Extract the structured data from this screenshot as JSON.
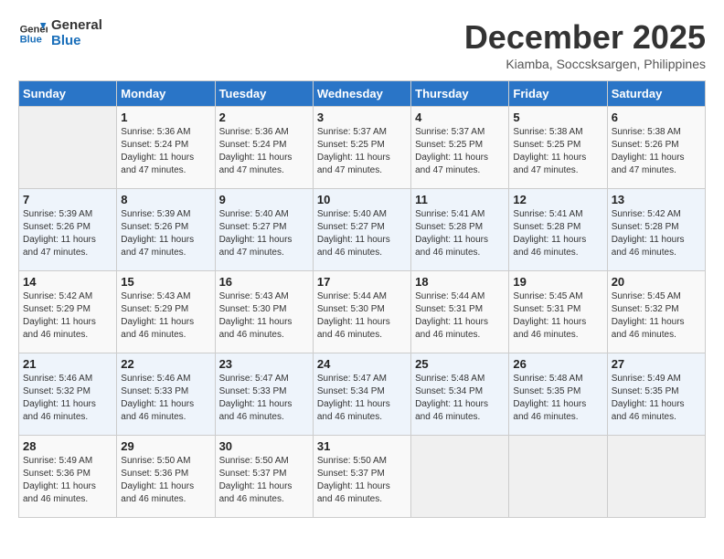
{
  "logo": {
    "line1": "General",
    "line2": "Blue"
  },
  "title": "December 2025",
  "subtitle": "Kiamba, Soccsksargen, Philippines",
  "headers": [
    "Sunday",
    "Monday",
    "Tuesday",
    "Wednesday",
    "Thursday",
    "Friday",
    "Saturday"
  ],
  "weeks": [
    [
      {
        "day": "",
        "sunrise": "",
        "sunset": "",
        "daylight": ""
      },
      {
        "day": "1",
        "sunrise": "Sunrise: 5:36 AM",
        "sunset": "Sunset: 5:24 PM",
        "daylight": "Daylight: 11 hours and 47 minutes."
      },
      {
        "day": "2",
        "sunrise": "Sunrise: 5:36 AM",
        "sunset": "Sunset: 5:24 PM",
        "daylight": "Daylight: 11 hours and 47 minutes."
      },
      {
        "day": "3",
        "sunrise": "Sunrise: 5:37 AM",
        "sunset": "Sunset: 5:25 PM",
        "daylight": "Daylight: 11 hours and 47 minutes."
      },
      {
        "day": "4",
        "sunrise": "Sunrise: 5:37 AM",
        "sunset": "Sunset: 5:25 PM",
        "daylight": "Daylight: 11 hours and 47 minutes."
      },
      {
        "day": "5",
        "sunrise": "Sunrise: 5:38 AM",
        "sunset": "Sunset: 5:25 PM",
        "daylight": "Daylight: 11 hours and 47 minutes."
      },
      {
        "day": "6",
        "sunrise": "Sunrise: 5:38 AM",
        "sunset": "Sunset: 5:26 PM",
        "daylight": "Daylight: 11 hours and 47 minutes."
      }
    ],
    [
      {
        "day": "7",
        "sunrise": "Sunrise: 5:39 AM",
        "sunset": "Sunset: 5:26 PM",
        "daylight": "Daylight: 11 hours and 47 minutes."
      },
      {
        "day": "8",
        "sunrise": "Sunrise: 5:39 AM",
        "sunset": "Sunset: 5:26 PM",
        "daylight": "Daylight: 11 hours and 47 minutes."
      },
      {
        "day": "9",
        "sunrise": "Sunrise: 5:40 AM",
        "sunset": "Sunset: 5:27 PM",
        "daylight": "Daylight: 11 hours and 47 minutes."
      },
      {
        "day": "10",
        "sunrise": "Sunrise: 5:40 AM",
        "sunset": "Sunset: 5:27 PM",
        "daylight": "Daylight: 11 hours and 46 minutes."
      },
      {
        "day": "11",
        "sunrise": "Sunrise: 5:41 AM",
        "sunset": "Sunset: 5:28 PM",
        "daylight": "Daylight: 11 hours and 46 minutes."
      },
      {
        "day": "12",
        "sunrise": "Sunrise: 5:41 AM",
        "sunset": "Sunset: 5:28 PM",
        "daylight": "Daylight: 11 hours and 46 minutes."
      },
      {
        "day": "13",
        "sunrise": "Sunrise: 5:42 AM",
        "sunset": "Sunset: 5:28 PM",
        "daylight": "Daylight: 11 hours and 46 minutes."
      }
    ],
    [
      {
        "day": "14",
        "sunrise": "Sunrise: 5:42 AM",
        "sunset": "Sunset: 5:29 PM",
        "daylight": "Daylight: 11 hours and 46 minutes."
      },
      {
        "day": "15",
        "sunrise": "Sunrise: 5:43 AM",
        "sunset": "Sunset: 5:29 PM",
        "daylight": "Daylight: 11 hours and 46 minutes."
      },
      {
        "day": "16",
        "sunrise": "Sunrise: 5:43 AM",
        "sunset": "Sunset: 5:30 PM",
        "daylight": "Daylight: 11 hours and 46 minutes."
      },
      {
        "day": "17",
        "sunrise": "Sunrise: 5:44 AM",
        "sunset": "Sunset: 5:30 PM",
        "daylight": "Daylight: 11 hours and 46 minutes."
      },
      {
        "day": "18",
        "sunrise": "Sunrise: 5:44 AM",
        "sunset": "Sunset: 5:31 PM",
        "daylight": "Daylight: 11 hours and 46 minutes."
      },
      {
        "day": "19",
        "sunrise": "Sunrise: 5:45 AM",
        "sunset": "Sunset: 5:31 PM",
        "daylight": "Daylight: 11 hours and 46 minutes."
      },
      {
        "day": "20",
        "sunrise": "Sunrise: 5:45 AM",
        "sunset": "Sunset: 5:32 PM",
        "daylight": "Daylight: 11 hours and 46 minutes."
      }
    ],
    [
      {
        "day": "21",
        "sunrise": "Sunrise: 5:46 AM",
        "sunset": "Sunset: 5:32 PM",
        "daylight": "Daylight: 11 hours and 46 minutes."
      },
      {
        "day": "22",
        "sunrise": "Sunrise: 5:46 AM",
        "sunset": "Sunset: 5:33 PM",
        "daylight": "Daylight: 11 hours and 46 minutes."
      },
      {
        "day": "23",
        "sunrise": "Sunrise: 5:47 AM",
        "sunset": "Sunset: 5:33 PM",
        "daylight": "Daylight: 11 hours and 46 minutes."
      },
      {
        "day": "24",
        "sunrise": "Sunrise: 5:47 AM",
        "sunset": "Sunset: 5:34 PM",
        "daylight": "Daylight: 11 hours and 46 minutes."
      },
      {
        "day": "25",
        "sunrise": "Sunrise: 5:48 AM",
        "sunset": "Sunset: 5:34 PM",
        "daylight": "Daylight: 11 hours and 46 minutes."
      },
      {
        "day": "26",
        "sunrise": "Sunrise: 5:48 AM",
        "sunset": "Sunset: 5:35 PM",
        "daylight": "Daylight: 11 hours and 46 minutes."
      },
      {
        "day": "27",
        "sunrise": "Sunrise: 5:49 AM",
        "sunset": "Sunset: 5:35 PM",
        "daylight": "Daylight: 11 hours and 46 minutes."
      }
    ],
    [
      {
        "day": "28",
        "sunrise": "Sunrise: 5:49 AM",
        "sunset": "Sunset: 5:36 PM",
        "daylight": "Daylight: 11 hours and 46 minutes."
      },
      {
        "day": "29",
        "sunrise": "Sunrise: 5:50 AM",
        "sunset": "Sunset: 5:36 PM",
        "daylight": "Daylight: 11 hours and 46 minutes."
      },
      {
        "day": "30",
        "sunrise": "Sunrise: 5:50 AM",
        "sunset": "Sunset: 5:37 PM",
        "daylight": "Daylight: 11 hours and 46 minutes."
      },
      {
        "day": "31",
        "sunrise": "Sunrise: 5:50 AM",
        "sunset": "Sunset: 5:37 PM",
        "daylight": "Daylight: 11 hours and 46 minutes."
      },
      {
        "day": "",
        "sunrise": "",
        "sunset": "",
        "daylight": ""
      },
      {
        "day": "",
        "sunrise": "",
        "sunset": "",
        "daylight": ""
      },
      {
        "day": "",
        "sunrise": "",
        "sunset": "",
        "daylight": ""
      }
    ]
  ]
}
